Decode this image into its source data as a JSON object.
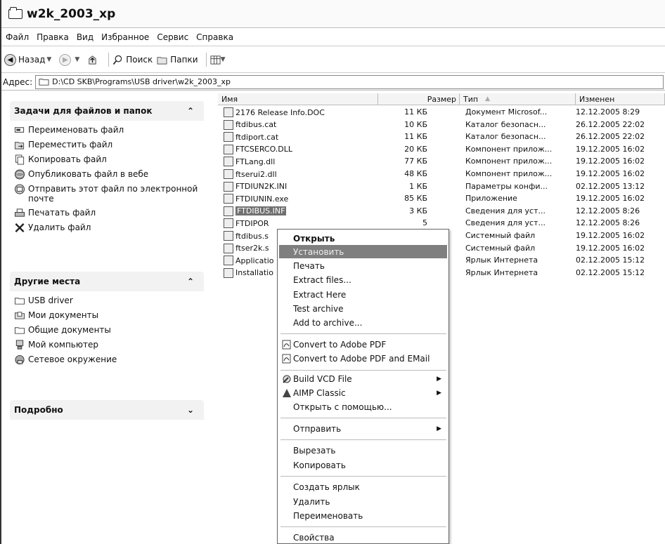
{
  "window": {
    "title": "w2k_2003_xp"
  },
  "menu": [
    "Файл",
    "Правка",
    "Вид",
    "Избранное",
    "Сервис",
    "Справка"
  ],
  "toolbar": {
    "back": "Назад",
    "search": "Поиск",
    "folders": "Папки"
  },
  "address": {
    "label": "Адрес:",
    "path": "D:\\CD SKB\\Programs\\USB driver\\w2k_2003_xp"
  },
  "tasks": {
    "title": "Задачи для файлов и папок",
    "items": [
      "Переименовать файл",
      "Переместить файл",
      "Копировать файл",
      "Опубликовать файл в вебе",
      "Отправить этот файл по электронной почте",
      "Печатать файл",
      "Удалить файл"
    ]
  },
  "places": {
    "title": "Другие места",
    "items": [
      "USB driver",
      "Мои документы",
      "Общие документы",
      "Мой компьютер",
      "Сетевое окружение"
    ]
  },
  "details": {
    "title": "Подробно"
  },
  "columns": {
    "name": "Имя",
    "size": "Размер",
    "type": "Тип",
    "date": "Изменен"
  },
  "files": [
    {
      "name": "2176 Release Info.DOC",
      "size": "11 КБ",
      "type": "Документ Microsof...",
      "date": "12.12.2005 8:29"
    },
    {
      "name": "ftdibus.cat",
      "size": "10 КБ",
      "type": "Каталог безопасн...",
      "date": "26.12.2005 22:02"
    },
    {
      "name": "ftdiport.cat",
      "size": "11 КБ",
      "type": "Каталог безопасн...",
      "date": "26.12.2005 22:02"
    },
    {
      "name": "FTCSERCO.DLL",
      "size": "20 КБ",
      "type": "Компонент прилож...",
      "date": "19.12.2005 16:02"
    },
    {
      "name": "FTLang.dll",
      "size": "77 КБ",
      "type": "Компонент прилож...",
      "date": "19.12.2005 16:02"
    },
    {
      "name": "ftserui2.dll",
      "size": "48 КБ",
      "type": "Компонент прилож...",
      "date": "19.12.2005 16:02"
    },
    {
      "name": "FTDIUN2K.INI",
      "size": "1 КБ",
      "type": "Параметры конфи...",
      "date": "02.12.2005 13:12"
    },
    {
      "name": "FTDIUNIN.exe",
      "size": "85 КБ",
      "type": "Приложение",
      "date": "19.12.2005 16:02"
    },
    {
      "name": "FTDIBUS.INF",
      "size": "3 КБ",
      "type": "Сведения для уст...",
      "date": "12.12.2005 8:26"
    },
    {
      "name": "FTDIPOR",
      "size": "5",
      "type": "Сведения для уст...",
      "date": "12.12.2005 8:26"
    },
    {
      "name": "ftdibus.s",
      "size": "5",
      "type": "Системный файл",
      "date": "19.12.2005 16:02"
    },
    {
      "name": "ftser2k.s",
      "size": "5",
      "type": "Системный файл",
      "date": "19.12.2005 16:02"
    },
    {
      "name": "Applicatio",
      "size": "5",
      "type": "Ярлык Интернета",
      "date": "02.12.2005 15:12"
    },
    {
      "name": "Installatio",
      "size": "5",
      "type": "Ярлык Интернета",
      "date": "02.12.2005 15:12"
    }
  ],
  "context_menu": [
    "Открыть",
    "Установить",
    "Печать",
    "Extract files...",
    "Extract Here",
    "Test archive",
    "Add to archive...",
    "Convert to Adobe PDF",
    "Convert to Adobe PDF and EMail",
    "Build VCD File",
    "AIMP Classic",
    "Открыть с помощью...",
    "Отправить",
    "Вырезать",
    "Копировать",
    "Создать ярлык",
    "Удалить",
    "Переименовать",
    "Свойства"
  ]
}
